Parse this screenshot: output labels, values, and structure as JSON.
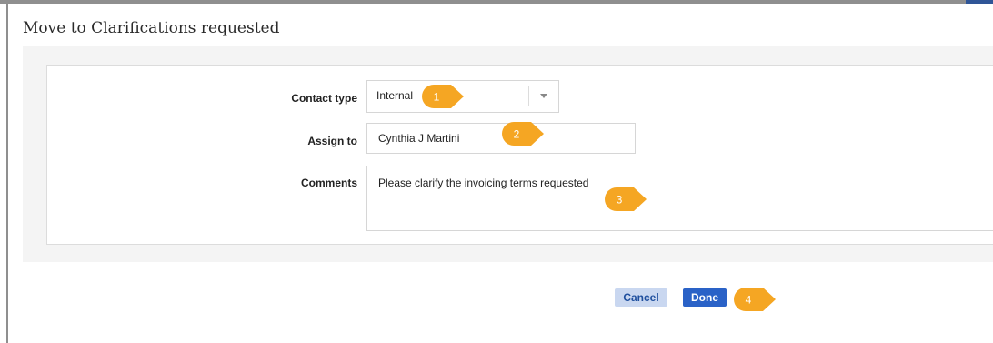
{
  "dialog": {
    "title": "Move to Clarifications requested"
  },
  "form": {
    "contact_type": {
      "label": "Contact type",
      "value": "Internal"
    },
    "assign_to": {
      "label": "Assign to",
      "value": "Cynthia J Martini"
    },
    "comments": {
      "label": "Comments",
      "value": "Please clarify the invoicing terms requested"
    }
  },
  "buttons": {
    "cancel_label": "Cancel",
    "done_label": "Done"
  },
  "step_markers": [
    "1",
    "2",
    "3",
    "4"
  ],
  "colors": {
    "marker": "#f5a623",
    "done_button": "#2a62c7",
    "cancel_button": "#c9d7f0"
  }
}
